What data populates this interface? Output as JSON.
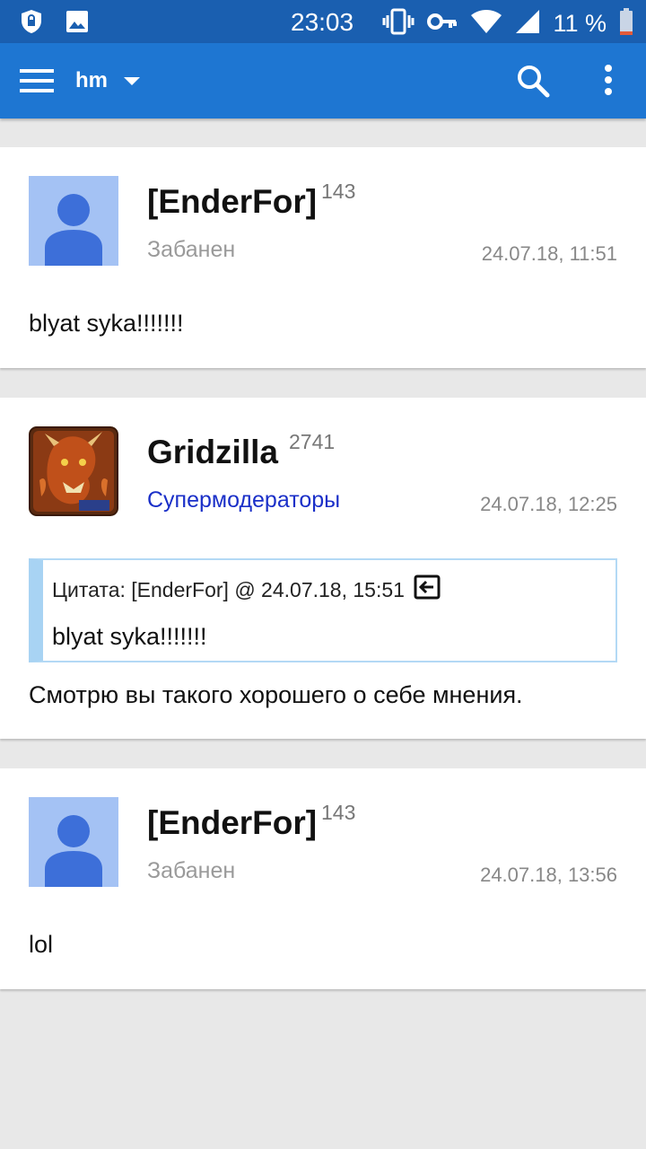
{
  "status_bar": {
    "time": "23:03",
    "battery": "11 %",
    "icons": [
      "shield-icon",
      "image-icon",
      "vibrate-icon",
      "key-icon",
      "wifi-icon",
      "signal-icon",
      "battery-icon"
    ]
  },
  "appbar": {
    "title": "hm",
    "icons": [
      "menu-icon",
      "dropdown-icon",
      "search-icon",
      "more-vert-icon"
    ],
    "color": "#1e76d2"
  },
  "posts": [
    {
      "author": "[EnderFor]",
      "reputation": "143",
      "group": "Забанен",
      "date": "24.07.18, 11:51",
      "body": "blyat syka!!!!!!!"
    },
    {
      "author": "Gridzilla",
      "reputation": "2741",
      "group": "Супермодераторы",
      "date": "24.07.18, 12:25",
      "quote": {
        "header": "Цитата: [EnderFor] @ 24.07.18, 15:51",
        "text": "blyat syka!!!!!!!"
      },
      "body": "Смотрю вы такого хорошего о себе мнения."
    },
    {
      "author": "[EnderFor]",
      "reputation": "143",
      "group": "Забанен",
      "date": "24.07.18, 13:56",
      "body": "lol"
    }
  ],
  "colors": {
    "moderator_group": "#1a2fc8",
    "quote_border": "#a8d3f3",
    "default_avatar_bg": "#a4c2f4",
    "default_avatar_fg": "#3d6fd9"
  }
}
